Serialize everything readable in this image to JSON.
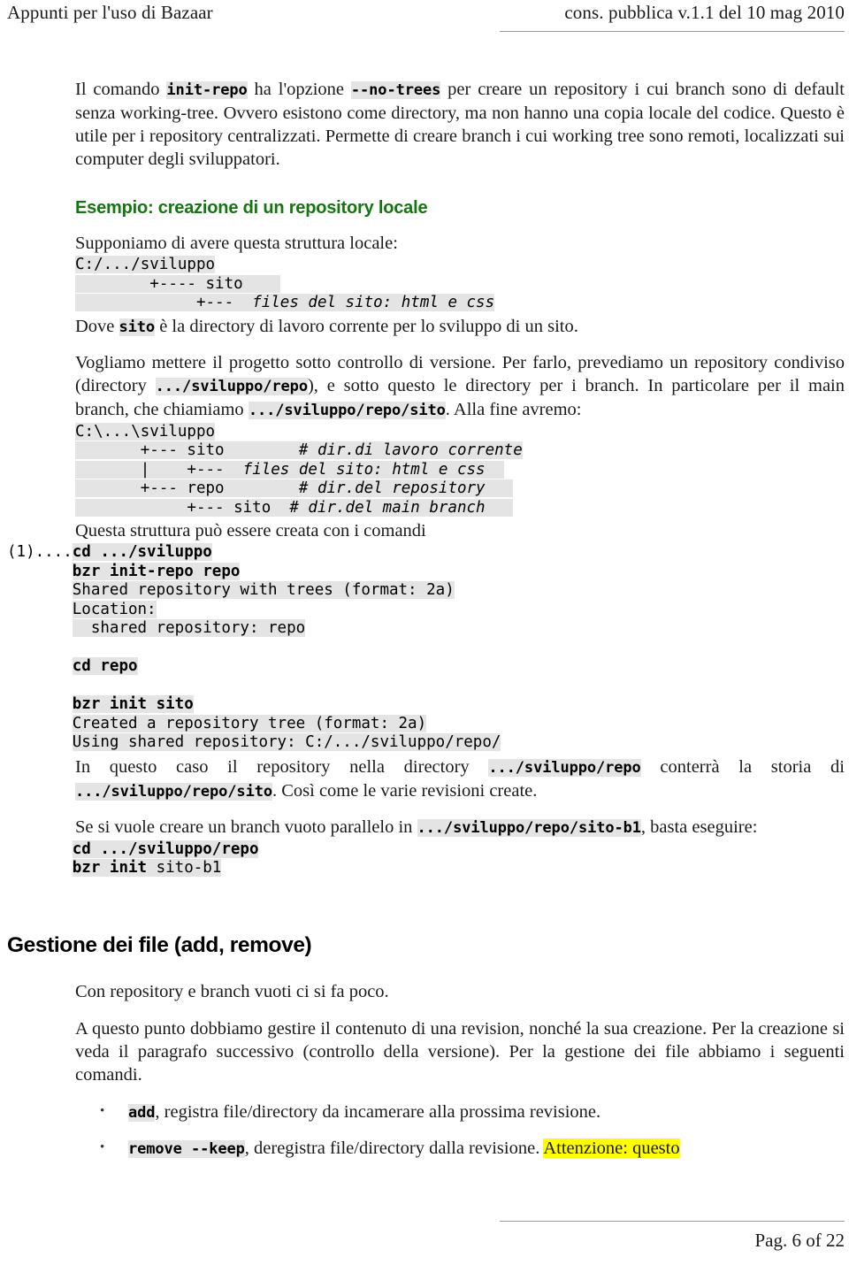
{
  "header": {
    "left_title": "Appunti per l'uso di Bazaar",
    "right_title": "cons. pubblica v.1.1 del 10 mag 2010"
  },
  "footer": {
    "page_label": "Pag. 6 of 22"
  },
  "colors": {
    "section_heading_green": "#13760f",
    "code_background": "#e4e4e4",
    "highlight_yellow": "#ffff00"
  },
  "intro": {
    "p1_a": "Il comando ",
    "p1_code1": "init-repo",
    "p1_b": " ha l'opzione ",
    "p1_code2": "--no-trees",
    "p1_c": " per creare un repository i cui branch sono di default senza working-tree. Ovvero esistono come directory, ma non hanno una copia locale del codice. Questo è utile per i repository centralizzati. Permette di creare branch i cui working tree sono remoti, localizzati sui computer degli sviluppatori."
  },
  "example_section": {
    "heading": "Esempio: creazione di un repository locale",
    "intro_line": "Supponiamo di avere questa struttura locale:",
    "tree1": [
      {
        "text": "C:/.../sviluppo",
        "style": "plain"
      },
      {
        "text": "        +---- sito",
        "style": "plain"
      },
      {
        "text": "             +---  ",
        "style": "plain",
        "italic_tail": "files del sito: html e css"
      }
    ],
    "tree1_raw": "C:/.../sviluppo\n        +---- sito\n             +---  files del sito: html e css",
    "after_tree1_a": "Dove ",
    "after_tree1_code": "sito",
    "after_tree1_b": " è la directory di lavoro corrente per lo sviluppo di un sito.",
    "p2_a": "Vogliamo mettere il progetto sotto controllo di versione. Per farlo, prevediamo un repository condiviso (directory ",
    "p2_code1": ".../sviluppo/repo",
    "p2_b": "), e sotto questo le directory per i branch. In particolare per il main branch, che chiamiamo ",
    "p2_code2": ".../sviluppo/repo/sito",
    "p2_c": ". Alla fine avremo:",
    "tree2_raw": "C:\\...\\sviluppo\n        +--- sito        # dir.di lavoro corrente\n        |    +---  files del sito: html e css\n        +--- repo        # dir.del repository\n             +--- sito  # dir.del main branch",
    "after_tree2": "Questa struttura può essere creata con i comandi",
    "step_marker": "(1)....",
    "cmd1": "cd .../sviluppo",
    "cmd2": "bzr init-repo repo",
    "out1": "Shared repository with trees (format: 2a)",
    "out2": "Location:",
    "out3": "  shared repository: repo",
    "cmd3": "cd repo",
    "cmd4": "bzr init sito",
    "out4": "Created a repository tree (format: 2a)",
    "out5": "Using shared repository: C:/.../sviluppo/repo/",
    "p3_a": "In questo caso il repository nella directory ",
    "p3_code1": ".../sviluppo/repo",
    "p3_b": " conterrà la storia di ",
    "p3_code2": ".../sviluppo/repo/sito",
    "p3_c": ". Così come le varie revisioni create.",
    "p4_a": "Se si vuole creare un branch vuoto parallelo in ",
    "p4_code1": ".../sviluppo/repo/sito-b1",
    "p4_b": ", basta eseguire:",
    "cmd5": "cd .../sviluppo/repo",
    "cmd6_bold": "bzr init ",
    "cmd6_rest": "sito-b1"
  },
  "file_section": {
    "heading": "Gestione dei file (add, remove)",
    "p1": "Con repository e branch vuoti ci si fa poco.",
    "p2": "A questo punto dobbiamo gestire il contenuto di una revision, nonché la sua creazione. Per la creazione si veda il paragrafo successivo (controllo della versione). Per la gestione dei file abbiamo i seguenti comandi.",
    "bullets": [
      {
        "code": "add",
        "text": ", registra file/directory da incamerare alla prossima revisione.",
        "highlight": ""
      },
      {
        "code": "remove --keep",
        "text": ", deregistra file/directory dalla revisione. ",
        "highlight": "Attenzione: questo"
      }
    ]
  }
}
